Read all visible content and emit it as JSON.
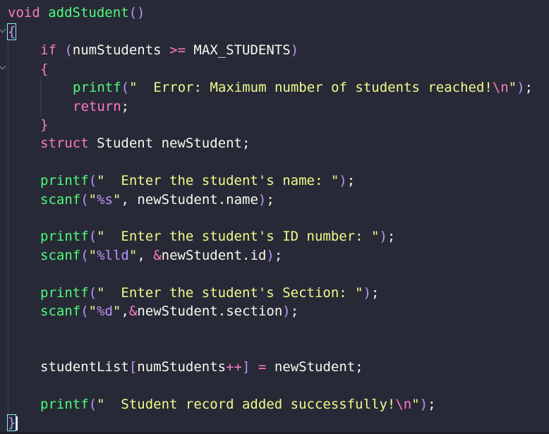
{
  "code": {
    "l1": {
      "kw": "void",
      "fn": "addStudent",
      "paren": "()"
    },
    "l2": {
      "brace": "{"
    },
    "l3": {
      "kw": "if",
      "p1": " (",
      "var": "numStudents",
      "op": ">=",
      "const": "MAX_STUDENTS",
      "p2": ")"
    },
    "l4": {
      "brace": "{"
    },
    "l5": {
      "fn": "printf",
      "p1": "(",
      "str": "\"  Error: Maximum number of students reached!",
      "esc": "\\n",
      "str2": "\"",
      "p2": ")",
      "semi": ";"
    },
    "l6": {
      "kw": "return",
      "semi": ";"
    },
    "l7": {
      "brace": "}"
    },
    "l8": {
      "kw": "struct",
      "rest": " Student newStudent;"
    },
    "l9": {
      "fn": "printf",
      "p1": "(",
      "str": "\"  Enter the student's name: \"",
      "p2": ")",
      "semi": ";"
    },
    "l10": {
      "fn": "scanf",
      "p1": "(",
      "q1": "\"",
      "fmt": "%s",
      "q2": "\"",
      "rest": ", newStudent.name",
      "p2": ")",
      "semi": ";"
    },
    "l11": {
      "fn": "printf",
      "p1": "(",
      "str": "\"  Enter the student's ID number: \"",
      "p2": ")",
      "semi": ";"
    },
    "l12": {
      "fn": "scanf",
      "p1": "(",
      "q1": "\"",
      "fmt": "%lld",
      "q2": "\"",
      "comma": ", ",
      "amp": "&",
      "rest": "newStudent.id",
      "p2": ")",
      "semi": ";"
    },
    "l13": {
      "fn": "printf",
      "p1": "(",
      "str": "\"  Enter the student's Section: \"",
      "p2": ")",
      "semi": ";"
    },
    "l14": {
      "fn": "scanf",
      "p1": "(",
      "q1": "\"",
      "fmt": "%d",
      "q2": "\"",
      "comma": ",",
      "amp": "&",
      "rest": "newStudent.section",
      "p2": ")",
      "semi": ";"
    },
    "l15": {
      "var": "studentList",
      "b1": "[",
      "idx": "numStudents",
      "inc": "++",
      "b2": "]",
      "eq": " = ",
      "rest": "newStudent;"
    },
    "l16": {
      "fn": "printf",
      "p1": "(",
      "str": "\"  Student record added successfully!",
      "esc": "\\n",
      "str2": "\"",
      "p2": ")",
      "semi": ";"
    },
    "l17": {
      "brace": "}"
    }
  },
  "colors": {
    "background": "#272a36",
    "keyword": "#ff79c6",
    "function": "#50fa7b",
    "string": "#f1fa8c",
    "bracket": "#bd93f9",
    "text": "#f8f8f2"
  }
}
